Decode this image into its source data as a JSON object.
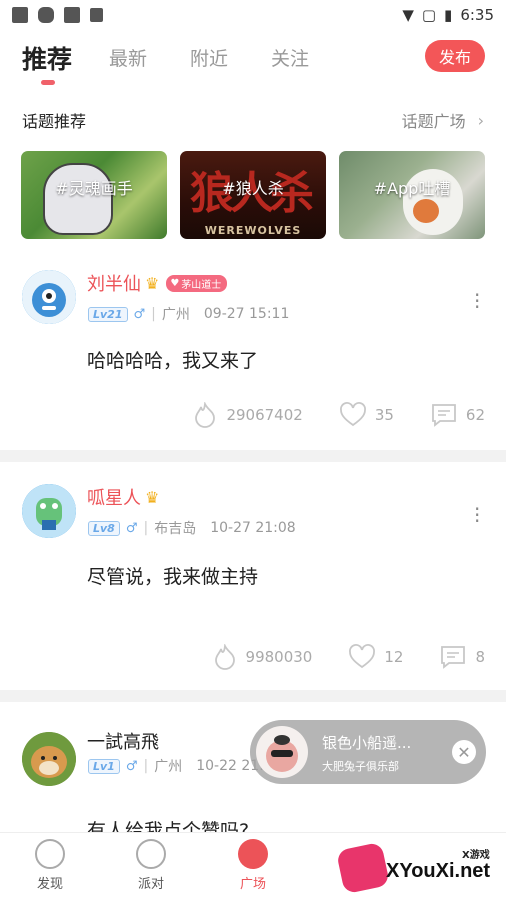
{
  "status_bar": {
    "time": "6:35"
  },
  "top_tabs": [
    {
      "label": "推荐"
    },
    {
      "label": "最新"
    },
    {
      "label": "附近"
    },
    {
      "label": "关注"
    }
  ],
  "publish_label": "发布",
  "topic_section": {
    "title": "话题推荐",
    "more_label": "话题广场",
    "cards": [
      {
        "label": "#灵魂画手"
      },
      {
        "label": "#狼人杀",
        "art_text": "狼人杀",
        "art_sub": "WEREWOLVES"
      },
      {
        "label": "#App吐槽"
      }
    ]
  },
  "posts": [
    {
      "username": "刘半仙",
      "badge": "茅山道士",
      "level": "Lv21",
      "gender": "♂",
      "location": "广州",
      "time": "09-27 15:11",
      "content": "哈哈哈哈，我又来了",
      "views": "29067402",
      "likes": "35",
      "comments": "62"
    },
    {
      "username": "呱星人",
      "level": "Lv8",
      "gender": "♂",
      "location": "布吉岛",
      "time": "10-27 21:08",
      "content": "尽管说，我来做主持",
      "views": "9980030",
      "likes": "12",
      "comments": "8"
    },
    {
      "username": "一試高飛",
      "level": "Lv1",
      "gender": "♂",
      "location": "广州",
      "time": "10-22 21:",
      "content": "有人给我点个赞吗?"
    }
  ],
  "floating_popup": {
    "title": "银色小船遥...",
    "subtitle": "大肥兔子俱乐部"
  },
  "bottom_nav": [
    {
      "label": "发现"
    },
    {
      "label": "派对"
    },
    {
      "label": "广场"
    }
  ],
  "watermark": {
    "text": "XYouXi.net",
    "small": "X游戏"
  },
  "colors": {
    "accent": "#ec5358",
    "publish": "#f35658",
    "level_blue": "#6aa8e8"
  }
}
